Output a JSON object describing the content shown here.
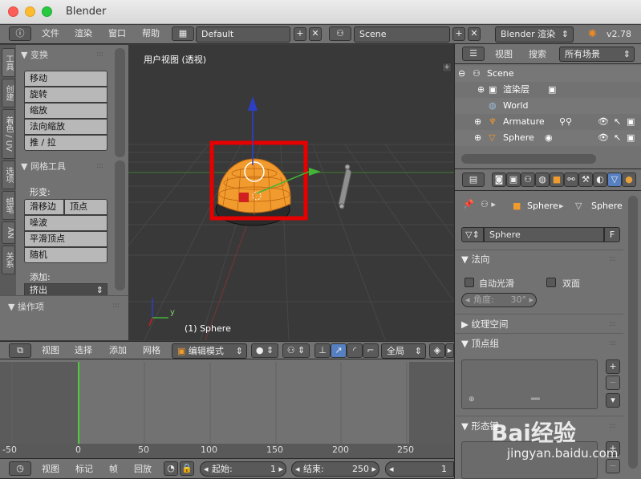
{
  "window": {
    "title": "Blender"
  },
  "top_menu": {
    "items": [
      "文件",
      "渲染",
      "窗口",
      "帮助"
    ],
    "layout": "Default",
    "scene": "Scene",
    "engine": "Blender 渲染",
    "version": "v2.78"
  },
  "tool_tabs": [
    "工具",
    "创建",
    "着色 / UV",
    "选项",
    "蜡笔",
    "AN",
    "关系"
  ],
  "toolshelf": {
    "transform_title": "变换",
    "transform_buttons": [
      "移动",
      "旋转",
      "缩放",
      "法向缩放",
      "推 / 拉"
    ],
    "mesh_tools_title": "网格工具",
    "deform_label": "形变:",
    "slide_edge": "滑移边",
    "vertex": "顶点",
    "deform_buttons": [
      "噪波",
      "平滑顶点",
      "随机"
    ],
    "add_label": "添加:",
    "extrude": "挤出",
    "operator_title": "操作项"
  },
  "viewport": {
    "view_label": "用户视图 (透视)",
    "object_label": "(1) Sphere",
    "axis_y": "y"
  },
  "view3d_header": {
    "menus": [
      "视图",
      "选择",
      "添加",
      "网格"
    ],
    "mode": "编辑模式",
    "orientation": "全局"
  },
  "timeline": {
    "ticks": [
      "-50",
      "0",
      "50",
      "100",
      "150",
      "200",
      "250"
    ],
    "menus": [
      "视图",
      "标记",
      "帧",
      "回放"
    ],
    "start_label": "起始:",
    "start_value": "1",
    "end_label": "结束:",
    "end_value": "250",
    "current_value": "1"
  },
  "outliner": {
    "menus": [
      "视图",
      "搜索"
    ],
    "filter": "所有场景",
    "rows": [
      "Scene",
      "渲染层",
      "World",
      "Armature",
      "Sphere"
    ]
  },
  "properties": {
    "breadcrumb": [
      "Sphere",
      "Sphere"
    ],
    "mesh_name": "Sphere",
    "fake_user": "F",
    "normals_title": "法向",
    "auto_smooth": "自动光滑",
    "double_sided": "双面",
    "angle_label": "角度:",
    "angle_value": "30°",
    "texture_space": "纹理空间",
    "vertex_groups": "顶点组",
    "shape_keys": "形态键"
  },
  "watermark": {
    "brand": "Bai经验",
    "url": "jingyan.baidu.com"
  },
  "colors": {
    "selection_box": "#e60000",
    "mesh_orange": "#f19a2e",
    "accent_blue": "#5680c2"
  }
}
